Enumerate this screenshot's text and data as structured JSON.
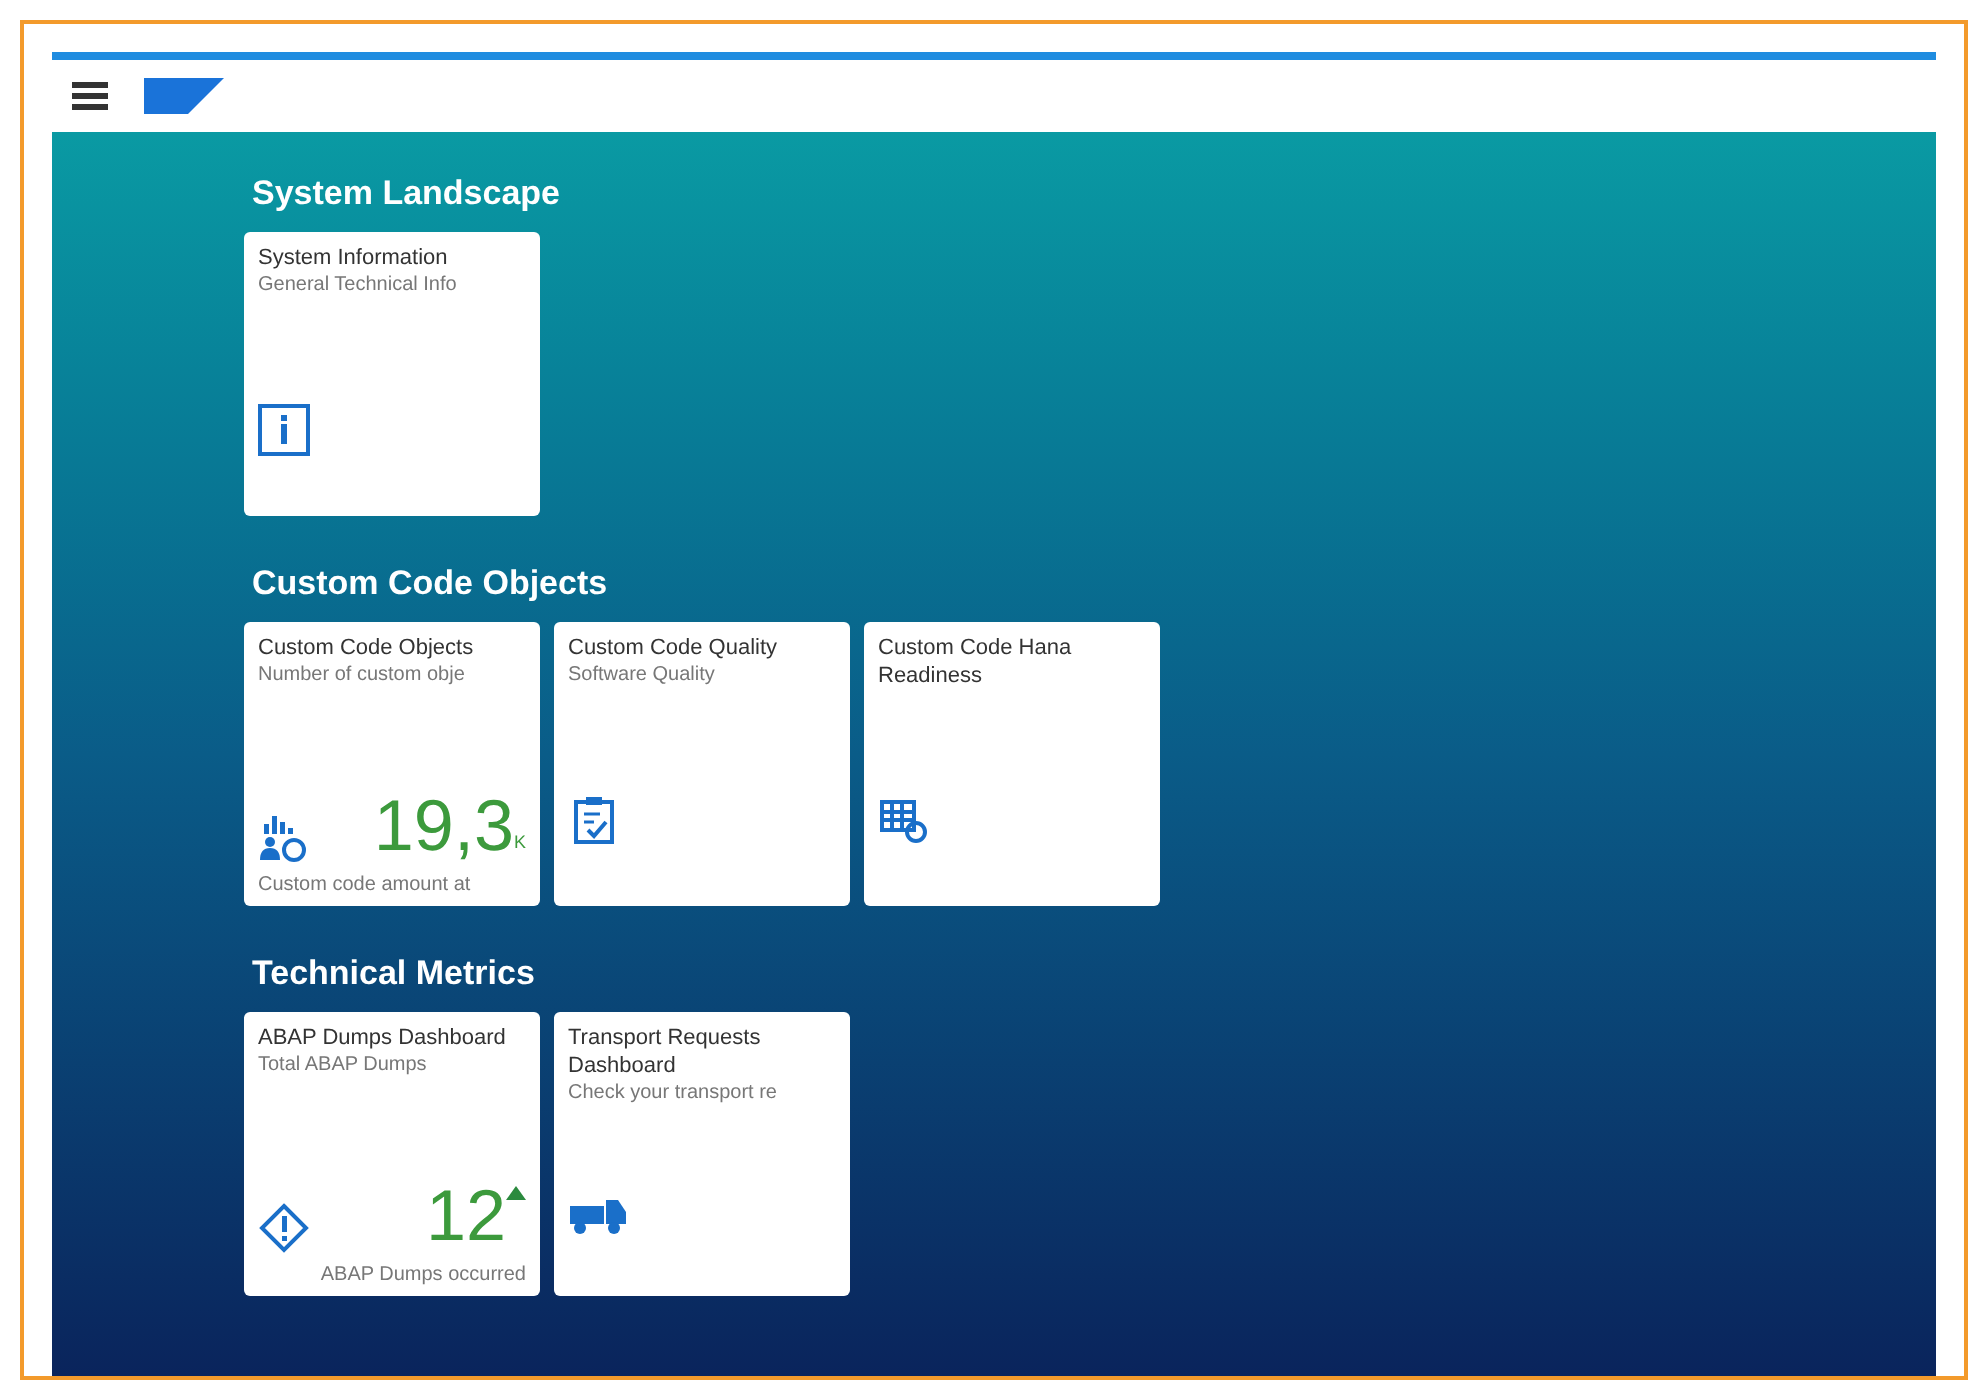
{
  "sections": [
    {
      "title": "System Landscape",
      "tiles": [
        {
          "kind": "launch",
          "title": "System Information",
          "subtitle": "General Technical Info"
        }
      ]
    },
    {
      "title": "Custom Code Objects",
      "tiles": [
        {
          "kind": "kpi",
          "title": "Custom Code Objects",
          "subtitle": "Number of custom obje",
          "value": "19,3",
          "scale": "K",
          "footer": "Custom code amount at"
        },
        {
          "kind": "launch",
          "title": "Custom Code Quality",
          "subtitle": "Software Quality"
        },
        {
          "kind": "launch",
          "title": "Custom Code Hana Readiness"
        }
      ]
    },
    {
      "title": "Technical Metrics",
      "tiles": [
        {
          "kind": "kpi",
          "title": "ABAP Dumps Dashboard",
          "subtitle": "Total ABAP Dumps",
          "value": "12",
          "rising": true,
          "footer": "ABAP Dumps occurred"
        },
        {
          "kind": "launch",
          "title": "Transport Requests Dashboard",
          "subtitle": "Check your transport re"
        }
      ]
    }
  ]
}
